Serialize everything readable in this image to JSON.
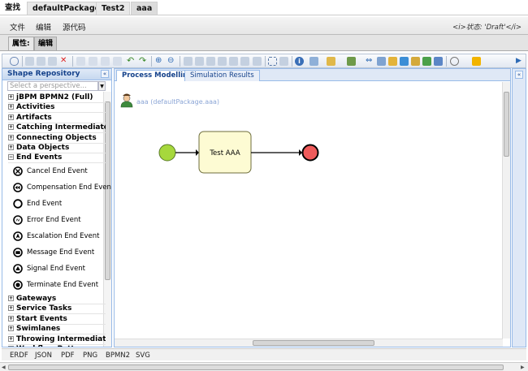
{
  "top_tabs": [
    "查找",
    "defaultPackage",
    "Test2",
    "aaa"
  ],
  "menu": [
    "文件",
    "编辑",
    "源代码"
  ],
  "status": "<i>状态: 'Draft'</i>",
  "sub_tabs": [
    "属性:",
    "编辑"
  ],
  "left_panel": {
    "title": "Shape Repository",
    "collapse_glyph": "«",
    "perspective_placeholder": "Select a perspective...",
    "groups_top": [
      {
        "label": "jBPM BPMN2 (Full)",
        "expanded": false
      },
      {
        "label": "Activities",
        "expanded": false
      },
      {
        "label": "Artifacts",
        "expanded": false
      },
      {
        "label": "Catching Intermediate Ev",
        "expanded": false
      },
      {
        "label": "Connecting Objects",
        "expanded": false
      },
      {
        "label": "Data Objects",
        "expanded": false
      },
      {
        "label": "End Events",
        "expanded": true
      }
    ],
    "end_events": [
      {
        "label": "Cancel End Event",
        "icon": "cancel-end-event-icon"
      },
      {
        "label": "Compensation End Event",
        "icon": "compensation-end-event-icon"
      },
      {
        "label": "End Event",
        "icon": "end-event-icon"
      },
      {
        "label": "Error End Event",
        "icon": "error-end-event-icon"
      },
      {
        "label": "Escalation End Event",
        "icon": "escalation-end-event-icon"
      },
      {
        "label": "Message End Event",
        "icon": "message-end-event-icon"
      },
      {
        "label": "Signal End Event",
        "icon": "signal-end-event-icon"
      },
      {
        "label": "Terminate End Event",
        "icon": "terminate-end-event-icon"
      }
    ],
    "groups_bottom": [
      {
        "label": "Gateways",
        "expanded": false
      },
      {
        "label": "Service Tasks",
        "expanded": false
      },
      {
        "label": "Start Events",
        "expanded": false
      },
      {
        "label": "Swimlanes",
        "expanded": false
      },
      {
        "label": "Throwing Intermediate E",
        "expanded": false
      },
      {
        "label": "Workflow Patterns",
        "expanded": false
      }
    ]
  },
  "canvas_tabs": [
    "Process Modelling",
    "Simulation Results"
  ],
  "canvas": {
    "process_label": "aaa (defaultPackage.aaa)",
    "task_label": "Test AAA",
    "colors": {
      "start_fill": "#a6d83c",
      "end_fill": "#ef5b5b",
      "task_fill": "#fdfbd3",
      "task_border": "#6e6e3c"
    }
  },
  "right_panel": {
    "collapse_glyph": "«"
  },
  "export_formats": [
    "ERDF",
    "JSON",
    "PDF",
    "PNG",
    "BPMN2",
    "SVG"
  ]
}
